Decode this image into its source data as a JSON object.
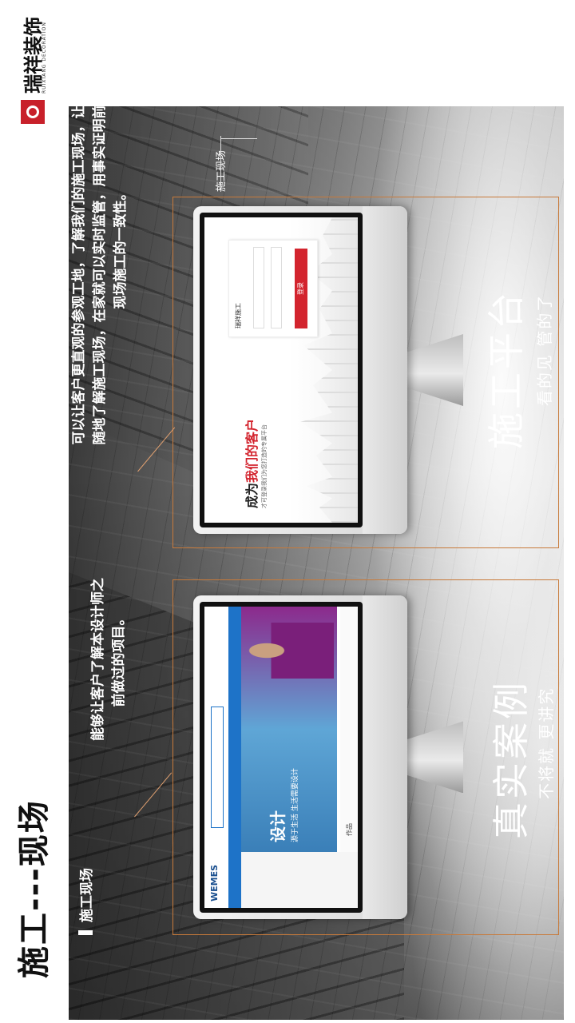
{
  "page": {
    "title": "施工---现场",
    "logo_name": "瑞祥装饰",
    "logo_en": "RUIXIANG DECORATION",
    "section_label": "施工现场",
    "corner_tag": "施工现场"
  },
  "left_panel": {
    "note": "能够让客户了解本设计师之前做过的项目。",
    "heading": "真实案例",
    "subheading": "不将就  更讲究",
    "site": {
      "logo": "WEMES",
      "banner_title": "设计",
      "banner_sub": "源于生活  生活需要设计",
      "footer": "作品"
    }
  },
  "right_panel": {
    "note": "可以让客户更直观的参观工地，了解我们的施工现场，让客户随时随地了解施工现场，在家就可以实时监管，用事实证明前期报价和现场施工的一致性。",
    "heading": "施工平台",
    "subheading": "看的见  管的了",
    "login": {
      "headline_prefix": "成为",
      "headline_highlight": "我们的客户",
      "subtext": "才可登录我们为您打造的专属平台",
      "brand": "瑞祥施工",
      "button": "登录"
    }
  },
  "colors": {
    "accent_red": "#c8202a",
    "frame_orange": "#c87a3a",
    "site_blue": "#1e73c8"
  }
}
